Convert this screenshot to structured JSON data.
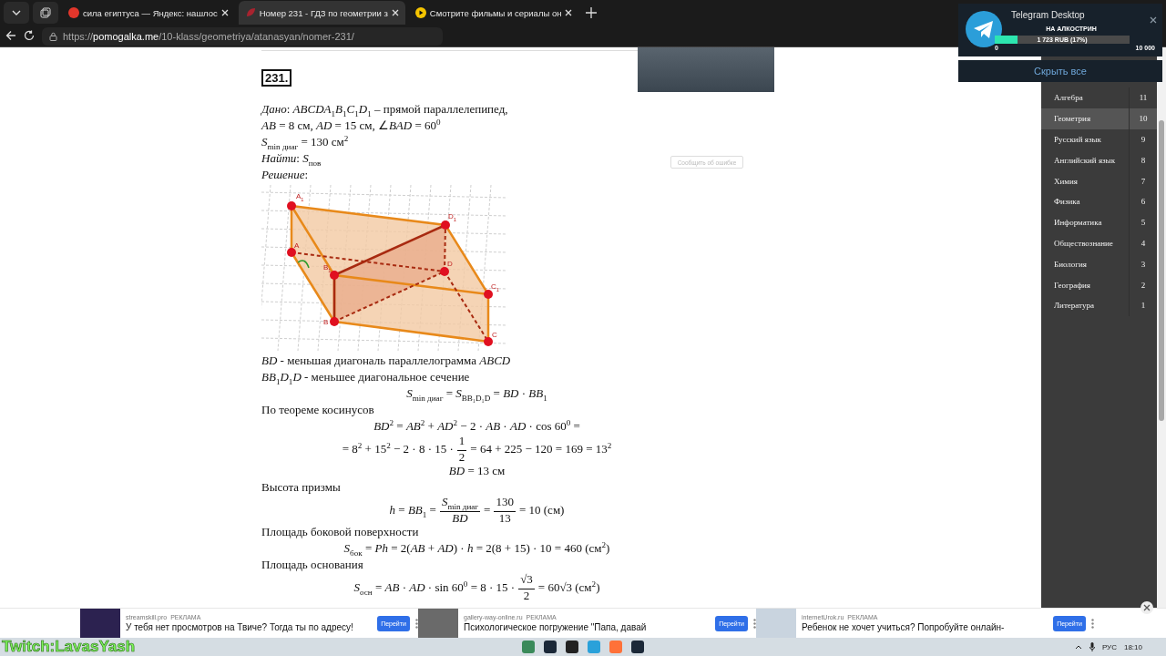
{
  "browser": {
    "tabs": [
      {
        "title": "сила египтуса — Яндекс: нашлос",
        "selected": false
      },
      {
        "title": "Номер 231 - ГДЗ по геометрии з",
        "selected": true
      },
      {
        "title": "Смотрите фильмы и сериалы он",
        "selected": false
      }
    ],
    "url": "https://**pomogalka.me**/10-klass/geometriya/atanasyan/nomer-231/"
  },
  "problem": {
    "number": "231.",
    "given": [
      "*Дано*: *ABCDA*$_{1}$*B*$_{1}$*C*$_{1}$*D*$_{1}$ – прямой параллелепипед,",
      "*AB* = 8 см, *AD* = 15 см, ∠*BAD* = 60$^{0}$",
      "*S*$_{min диаг}$ = 130 см$^{2}$",
      "*Найти*: *S*$_{пов}$",
      "*Решение*:"
    ],
    "figure": {
      "vertex_labels": [
        "A$_{1}$",
        "D$_{1}$",
        "A",
        "B$_{1}$",
        "D",
        "C$_{1}$",
        "B",
        "C"
      ]
    },
    "steps": [
      {
        "kind": "text",
        "text": "*BD* - меньшая диагональ параллелограмма *ABCD*"
      },
      {
        "kind": "text",
        "text": "*BB*$_{1}$*D*$_{1}$*D* - меньшее диагональное сечение"
      },
      {
        "kind": "formula",
        "parts": [
          {
            "kind": "text",
            "text": "*S*$_{min диаг}$ = *S*$_{BB₁D₁D}$ = *BD* · *BB*$_{1}$"
          }
        ]
      },
      {
        "kind": "text",
        "text": "По теореме косинусов"
      },
      {
        "kind": "formula",
        "parts": [
          {
            "kind": "text",
            "text": "*BD*$^{2}$ = *AB*$^{2}$ + *AD*$^{2}$ − 2 · *AB* · *AD* · cos 60$^{0}$ ="
          }
        ]
      },
      {
        "kind": "formula",
        "parts": [
          {
            "kind": "text",
            "text": "= 8$^{2}$ + 15$^{2}$ − 2 · 8 · 15 ·"
          },
          {
            "kind": "frac",
            "num": "1",
            "den": "2"
          },
          {
            "kind": "text",
            "text": "= 64 + 225 − 120 = 169 = 13$^{2}$"
          }
        ]
      },
      {
        "kind": "formula",
        "parts": [
          {
            "kind": "text",
            "text": "*BD* = 13 см"
          }
        ]
      },
      {
        "kind": "text",
        "text": "Высота призмы"
      },
      {
        "kind": "formula",
        "parts": [
          {
            "kind": "text",
            "text": "*h* = *BB*$_{1}$ ="
          },
          {
            "kind": "frac",
            "num": "*S*$_{min диаг}$",
            "den": "*BD*"
          },
          {
            "kind": "text",
            "text": "="
          },
          {
            "kind": "frac",
            "num": "130",
            "den": "13"
          },
          {
            "kind": "text",
            "text": "= 10 (см)"
          }
        ]
      },
      {
        "kind": "text",
        "text": "Площадь боковой поверхности"
      },
      {
        "kind": "formula",
        "parts": [
          {
            "kind": "text",
            "text": "*S*$_{бок}$ = *Ph* = 2(*AB* + *AD*) · *h* = 2(8 + 15) · 10 = 460 (см$^{2}$)"
          }
        ]
      },
      {
        "kind": "text",
        "text": "Площадь основания"
      },
      {
        "kind": "formula",
        "parts": [
          {
            "kind": "text",
            "text": "*S*$_{осн}$ = *AB* · *AD* · sin 60$^{0}$ = 8 · 15 ·"
          },
          {
            "kind": "frac",
            "num": "√3",
            "den": "2"
          },
          {
            "kind": "text",
            "text": "= 60√3 (см$^{2}$)"
          }
        ]
      }
    ]
  },
  "report_button": "Сообщить об ошибке",
  "subjects": [
    {
      "name": "Алгебра",
      "count": "11",
      "selected": false
    },
    {
      "name": "Геометрия",
      "count": "10",
      "selected": true
    },
    {
      "name": "Русский язык",
      "count": "9",
      "selected": false
    },
    {
      "name": "Английский язык",
      "count": "8",
      "selected": false
    },
    {
      "name": "Химия",
      "count": "7",
      "selected": false
    },
    {
      "name": "Физика",
      "count": "6",
      "selected": false
    },
    {
      "name": "Информатика",
      "count": "5",
      "selected": false
    },
    {
      "name": "Обществознание",
      "count": "4",
      "selected": false
    },
    {
      "name": "Биология",
      "count": "3",
      "selected": false
    },
    {
      "name": "География",
      "count": "2",
      "selected": false
    },
    {
      "name": "Литература",
      "count": "1",
      "selected": false
    }
  ],
  "notification": {
    "app": "Telegram Desktop",
    "heading": "НА АЛКОСТРИН",
    "level": 0.17,
    "reading": "1 723 RUB (17%)",
    "min": "0",
    "max": "10 000",
    "hide_all": "Скрыть все"
  },
  "ads": [
    {
      "source": "streamskill.pro",
      "tag": "РЕКЛАМА",
      "title": "У тебя нет просмотров на Твиче? Тогда ты по адресу!",
      "button": "Перейти"
    },
    {
      "source": "gallery-way-online.ru",
      "tag": "РЕКЛАМА",
      "title": "Психологическое погружение \"Папа, давай",
      "button": "Перейти"
    },
    {
      "source": "internetUrok.ru",
      "tag": "РЕКЛАМА",
      "title": "Ребенок не хочет учиться? Попробуйте онлайн-",
      "button": "Перейти"
    }
  ],
  "overlay_text": "Twitch:LavasYash",
  "taskbar": {
    "language": "РУС",
    "time": "18:10"
  }
}
